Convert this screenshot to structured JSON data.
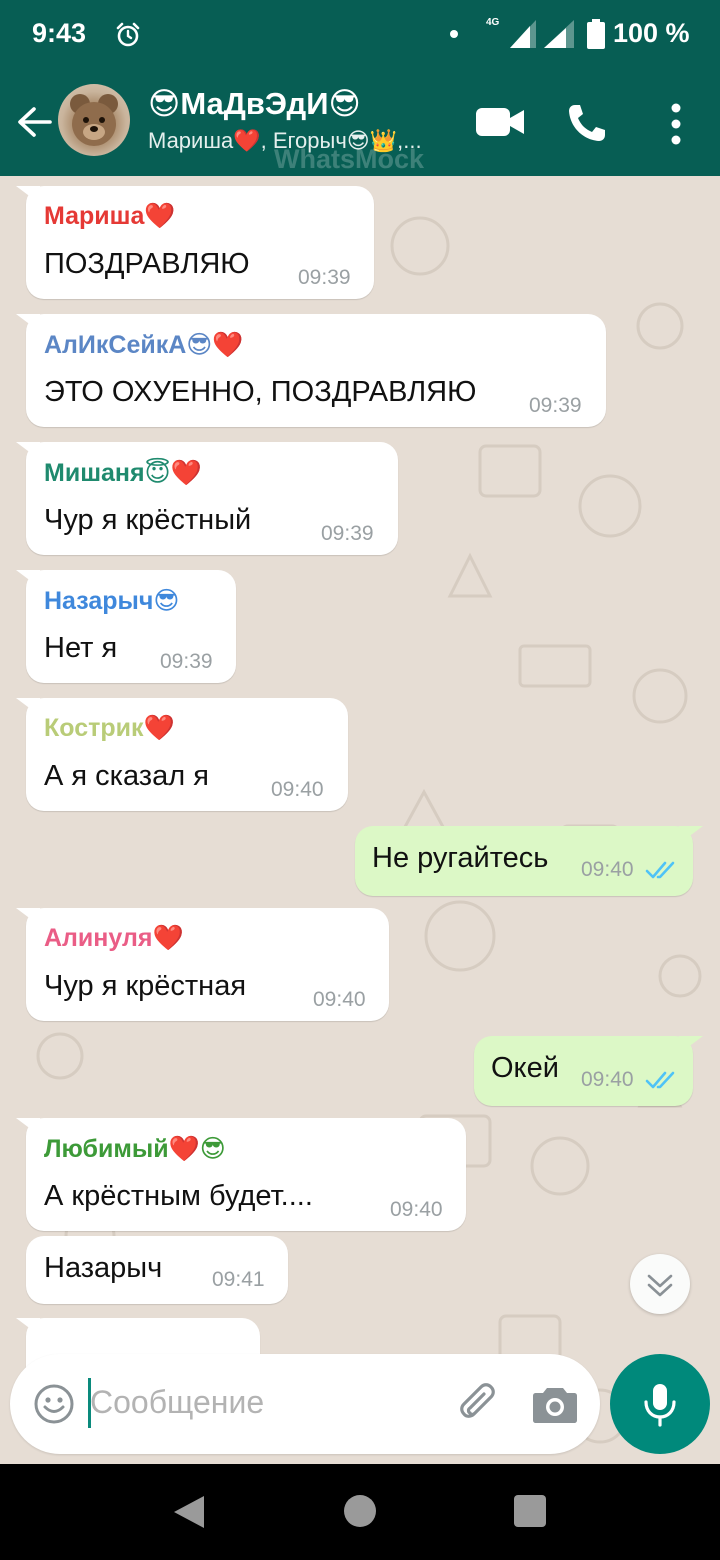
{
  "status_bar": {
    "time": "9:43",
    "network": "4G",
    "battery": "100 %",
    "icons": [
      "alarm-icon",
      "dot-icon",
      "signal-icon",
      "signal-icon",
      "battery-icon"
    ]
  },
  "header": {
    "title": "😎МаДвЭдИ😎",
    "subtitle": "Мариша❤️, Егорыч😎👑,...",
    "watermark": "WhatsMock",
    "icons": [
      "back-arrow-icon",
      "group-avatar",
      "video-call-icon",
      "phone-icon",
      "more-vert-icon"
    ]
  },
  "messages": [
    {
      "direction": "in",
      "sender": "Мариша❤️",
      "sender_color": "#e53935",
      "text": "ПОЗДРАВЛЯЮ",
      "time": "09:39"
    },
    {
      "direction": "in",
      "sender": "АлИкСейкА😎❤️",
      "sender_color": "#5b86c5",
      "text": "ЭТО ОХУЕННО, ПОЗДРАВЛЯЮ",
      "time": "09:39"
    },
    {
      "direction": "in",
      "sender": "Мишаня😇❤️",
      "sender_color": "#1f8a6e",
      "text": "Чур я крёстный",
      "time": "09:39"
    },
    {
      "direction": "in",
      "sender": "Назарыч😎",
      "sender_color": "#3f88dc",
      "text": "Нет я",
      "time": "09:39"
    },
    {
      "direction": "in",
      "sender": "Кострик❤️",
      "sender_color": "#b9cc78",
      "text": "А  я сказал я",
      "time": "09:40"
    },
    {
      "direction": "out",
      "text": "Не ругайтесь",
      "time": "09:40",
      "status": "read"
    },
    {
      "direction": "in",
      "sender": "Алинуля❤️",
      "sender_color": "#ea5d86",
      "text": "Чур я крёстная",
      "time": "09:40"
    },
    {
      "direction": "out",
      "text": "Окей",
      "time": "09:40",
      "status": "read"
    },
    {
      "direction": "in",
      "sender": "Любимый❤️😎",
      "sender_color": "#3d9a38",
      "text": "А крёстным будет....",
      "time": "09:40"
    },
    {
      "direction": "in",
      "text": "Назарыч",
      "time": "09:41"
    }
  ],
  "colors": {
    "header_bg": "#075e54",
    "chat_bg": "#e6ddd4",
    "outgoing_bubble": "#dcf8c6",
    "read_ticks": "#4fc3f7",
    "accent": "#00897b"
  },
  "composer": {
    "placeholder": "Сообщение",
    "icons": [
      "emoji-icon",
      "attach-icon",
      "camera-icon",
      "mic-icon"
    ]
  },
  "nav_bar": {
    "icons": [
      "nav-back-icon",
      "nav-home-icon",
      "nav-recents-icon"
    ]
  }
}
